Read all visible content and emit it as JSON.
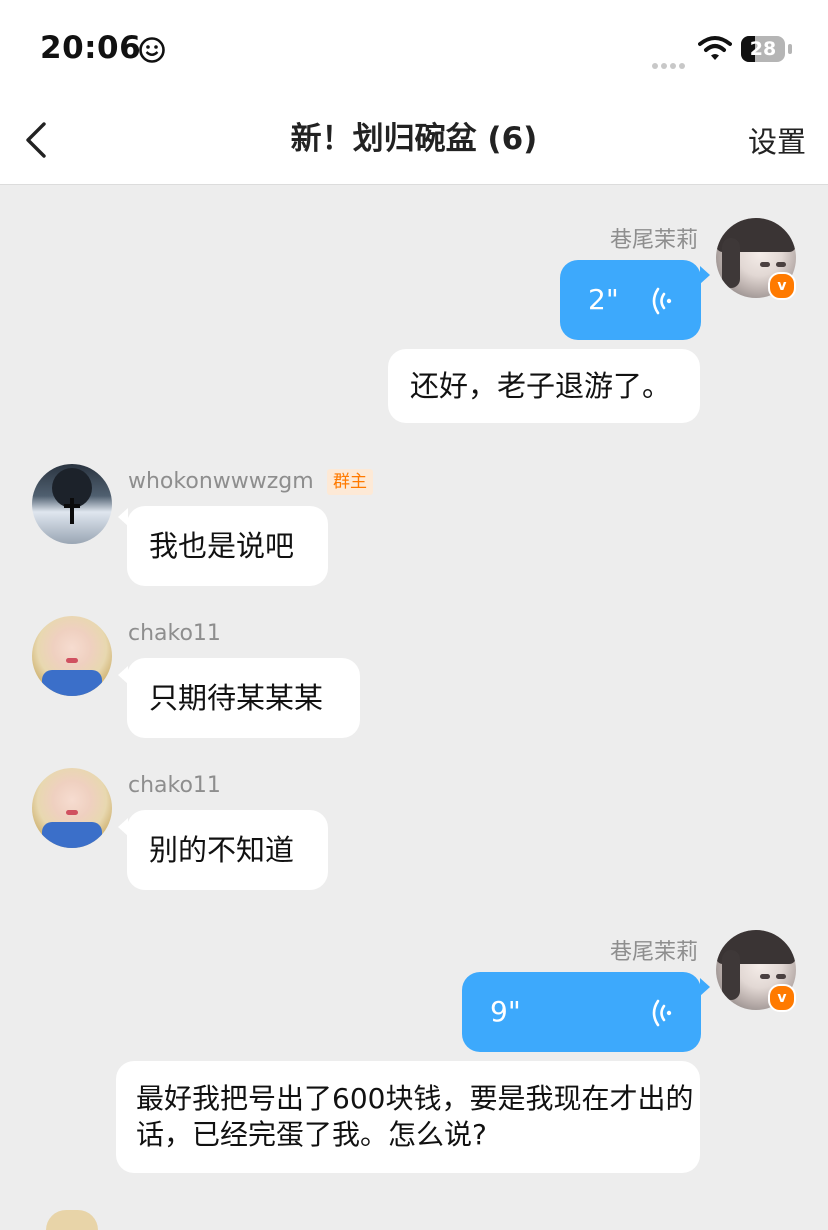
{
  "status_bar": {
    "time": "20:06",
    "battery": "28"
  },
  "header": {
    "title": "新！划归碗盆 (6)",
    "settings_label": "设置"
  },
  "messages": [
    {
      "sender": "巷尾茉莉",
      "side": "right",
      "type": "voice",
      "duration": "2\""
    },
    {
      "side": "right",
      "type": "text",
      "text": "还好，老子退游了。"
    },
    {
      "sender": "whokonwwwzgm",
      "role": "群主",
      "side": "left",
      "type": "text",
      "text": "我也是说吧"
    },
    {
      "sender": "chako11",
      "side": "left",
      "type": "text",
      "text": "只期待某某某"
    },
    {
      "sender": "chako11",
      "side": "left",
      "type": "text",
      "text": "别的不知道"
    },
    {
      "sender": "巷尾茉莉",
      "side": "right",
      "type": "voice",
      "duration": "9\""
    },
    {
      "side": "right",
      "type": "text",
      "text": "最好我把号出了600块钱，要是我现在才出的话，已经完蛋了我。怎么说?"
    }
  ],
  "badges": {
    "verified": "v"
  },
  "colors": {
    "voice_bubble": "#3da9fc",
    "background": "#ededed",
    "verified_badge": "#ff7a00"
  }
}
